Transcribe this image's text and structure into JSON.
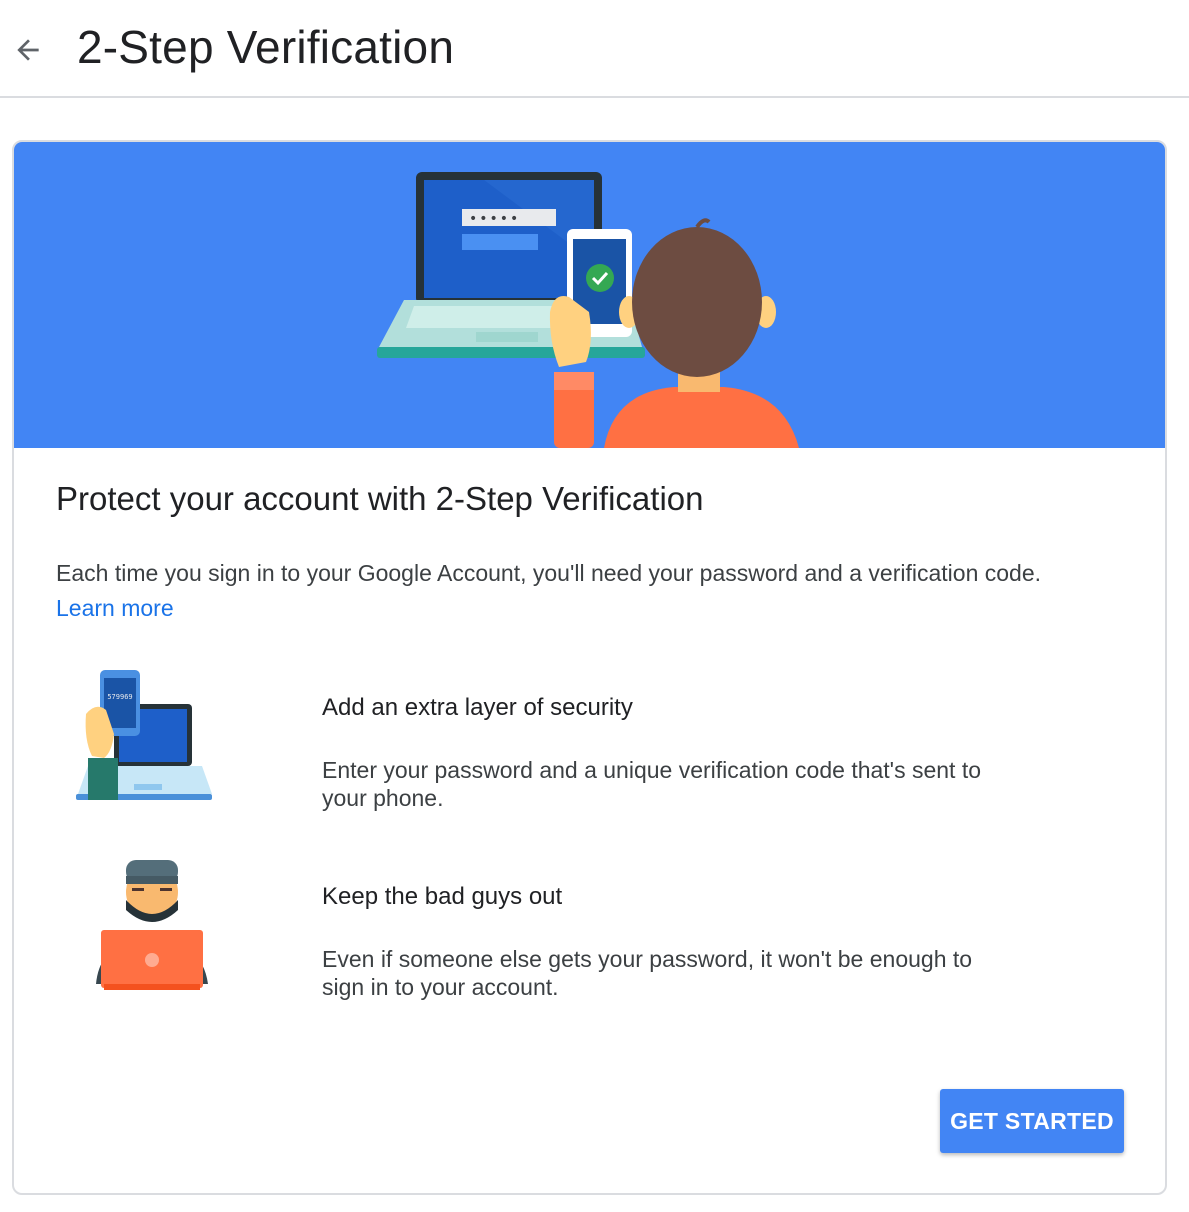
{
  "header": {
    "title": "2-Step Verification",
    "back_icon": "arrow-back-icon"
  },
  "card": {
    "banner_color": "#4285f4",
    "hero_phone_code": "•••••",
    "heading": "Protect your account with 2-Step Verification",
    "intro_text": "Each time you sign in to your Google Account, you'll need your password and a verification code.",
    "learn_more_label": "Learn more",
    "features": [
      {
        "icon": "phone-code-laptop-icon",
        "code": "579969",
        "title": "Add an extra layer of security",
        "description": "Enter your password and a unique verification code that's sent to your phone."
      },
      {
        "icon": "hacker-laptop-icon",
        "title": "Keep the bad guys out",
        "description": "Even if someone else gets your password, it won't be enough to sign in to your account."
      }
    ],
    "cta_label": "GET STARTED"
  },
  "colors": {
    "accent": "#4285f4",
    "link": "#1a73e8",
    "text": "#202124",
    "secondary_text": "#3c4043",
    "divider": "#dadce0"
  }
}
